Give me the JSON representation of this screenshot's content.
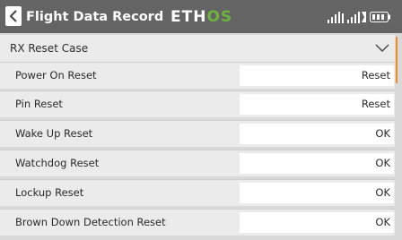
{
  "header": {
    "title": "Flight Data Record",
    "logo_main": "ETH",
    "logo_accent": "OS",
    "colors": {
      "bar": "#646464",
      "accent": "#6db33f",
      "scrollbar": "#f08c1e"
    },
    "icons": [
      "back-arrow-icon",
      "rf-signal-icon",
      "telemetry-signal-icon",
      "battery-icon"
    ]
  },
  "section": {
    "title": "RX Reset Case",
    "state_icon": "chevron-down-icon"
  },
  "rows": [
    {
      "label": "Power On Reset",
      "value": "Reset"
    },
    {
      "label": "Pin Reset",
      "value": "Reset"
    },
    {
      "label": "Wake Up Reset",
      "value": "OK"
    },
    {
      "label": "Watchdog Reset",
      "value": "OK"
    },
    {
      "label": "Lockup Reset",
      "value": "OK"
    },
    {
      "label": "Brown Down Detection Reset",
      "value": "OK"
    }
  ]
}
